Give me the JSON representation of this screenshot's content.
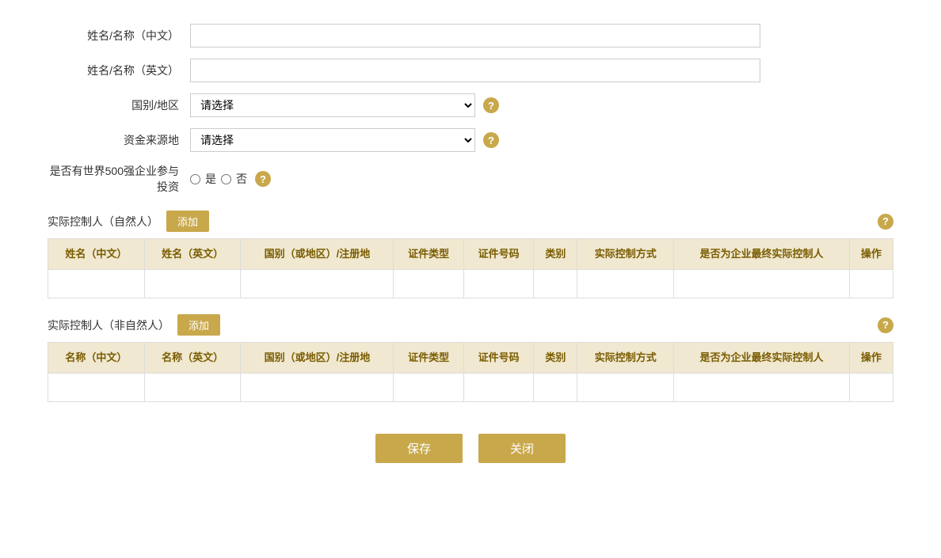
{
  "form": {
    "name_cn_label": "姓名/名称（中文）",
    "name_en_label": "姓名/名称（英文）",
    "country_label": "国别/地区",
    "country_placeholder": "请选择",
    "fund_source_label": "资金来源地",
    "fund_source_placeholder": "请选择",
    "fortune500_label": "是否有世界500强企业参与投资",
    "fortune500_yes": "是",
    "fortune500_no": "否",
    "name_cn_value": "",
    "name_en_value": ""
  },
  "natural_person_section": {
    "title": "实际控制人（自然人）",
    "add_label": "添加",
    "columns": [
      "姓名（中文）",
      "姓名（英文）",
      "国别（或地区）/注册地",
      "证件类型",
      "证件号码",
      "类别",
      "实际控制方式",
      "是否为企业最终实际控制人",
      "操作"
    ]
  },
  "non_natural_person_section": {
    "title": "实际控制人（非自然人）",
    "add_label": "添加",
    "columns": [
      "名称（中文）",
      "名称（英文）",
      "国别（或地区）/注册地",
      "证件类型",
      "证件号码",
      "类别",
      "实际控制方式",
      "是否为企业最终实际控制人",
      "操作"
    ]
  },
  "buttons": {
    "save_label": "保存",
    "close_label": "关闭"
  },
  "icons": {
    "help": "?",
    "dropdown": "▾"
  }
}
